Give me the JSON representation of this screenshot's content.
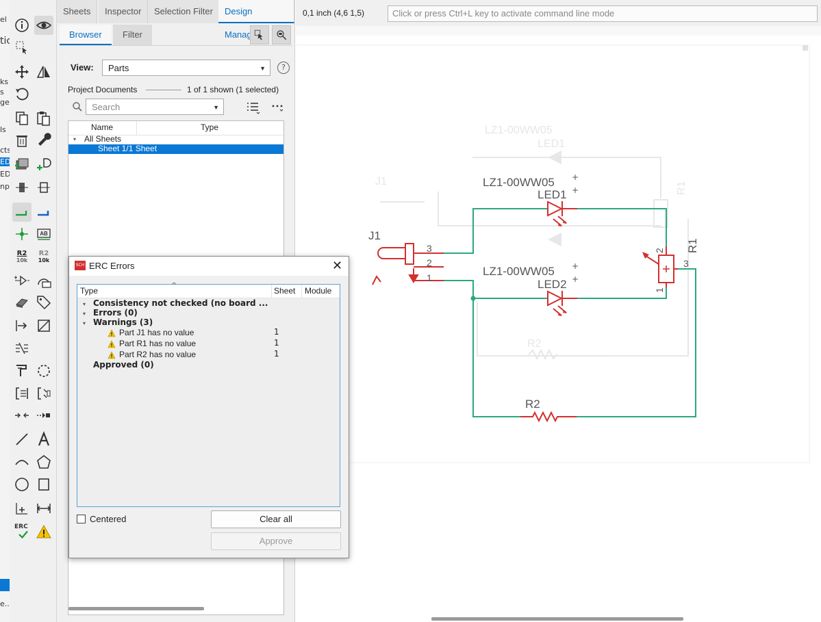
{
  "left_strip": {
    "items": [
      "el -",
      "tic",
      "ks",
      "s",
      "ge",
      "ls",
      "cts",
      "ED",
      "ED",
      "npl",
      "e..."
    ]
  },
  "panel": {
    "tabs": [
      "Sheets",
      "Inspector",
      "Selection Filter",
      "Design Manager"
    ],
    "subtabs": [
      "Browser",
      "Filter"
    ],
    "view_label": "View:",
    "view_value": "Parts",
    "project_documents": "Project Documents",
    "shown_count": "1 of 1 shown (1 selected)",
    "search_placeholder": "Search",
    "col_name": "Name",
    "col_type": "Type",
    "tree_root": "All Sheets",
    "tree_child": "Sheet 1/1 Sheet"
  },
  "cmdbar": {
    "coords": "0,1 inch (4,6 1,5)",
    "command_placeholder": "Click or press Ctrl+L key to activate command line mode"
  },
  "schematic": {
    "labels": {
      "j1": "J1",
      "led1_value": "LZ1-00WW05",
      "led1_name": "LED1",
      "led2_value": "LZ1-00WW05",
      "led2_name": "LED2",
      "r1": "R1",
      "r2": "R2",
      "j1_pin3": "3",
      "j1_pin2": "2",
      "j1_pin1": "1",
      "r1_pin2": "2",
      "r1_pin3": "3",
      "r1_pin1": "1",
      "ghost_led_value": "LZ1-00WW05",
      "ghost_led_name": "LED1",
      "ghost_j1": "J1",
      "ghost_r1": "R1",
      "ghost_r2": "R2"
    },
    "colors": {
      "part": "#d32f2f",
      "wire": "#2aa87e",
      "text": "#555555"
    }
  },
  "dialog": {
    "title": "ERC Errors",
    "col_type": "Type",
    "col_sheet": "Sheet",
    "col_module": "Module",
    "rows": [
      {
        "label": "Consistency not checked (no board ...",
        "sheet": ""
      },
      {
        "label": "Errors (0)",
        "sheet": ""
      },
      {
        "label": "Warnings (3)",
        "sheet": ""
      },
      {
        "label": "Part J1 has no value",
        "sheet": "1"
      },
      {
        "label": "Part R1 has no value",
        "sheet": "1"
      },
      {
        "label": "Part R2 has no value",
        "sheet": "1"
      },
      {
        "label": "Approved (0)",
        "sheet": ""
      }
    ],
    "centered_label": "Centered",
    "clear_all": "Clear all",
    "approve": "Approve"
  },
  "toolbar": {
    "icons": [
      "info-icon",
      "eye-icon",
      "select-rect-icon",
      "move-icon",
      "mirror-icon",
      "rotate-icon",
      "copy-icon",
      "paste-icon",
      "delete-icon",
      "wrench-icon",
      "add-part-icon",
      "add-gate-icon",
      "replace-icon",
      "split-icon",
      "wire-icon",
      "bus-icon",
      "junction-icon",
      "label-icon",
      "value-icon",
      "smash-icon",
      "gate-swap-icon",
      "pin-swap-icon",
      "attribute-icon",
      "tag-icon",
      "arrow-icon",
      "line-icon",
      "a-icon",
      "arc-icon",
      "polygon-icon",
      "circle-icon",
      "rect-icon",
      "mark-icon",
      "dimension-icon",
      "erc-icon",
      "warning-icon"
    ],
    "value_label_1": "R2",
    "value_label_1_sub": "10k",
    "value_label_2": "R2",
    "value_label_2_sub": "10k",
    "label_ab": "AB",
    "erc_text": "ERC"
  }
}
